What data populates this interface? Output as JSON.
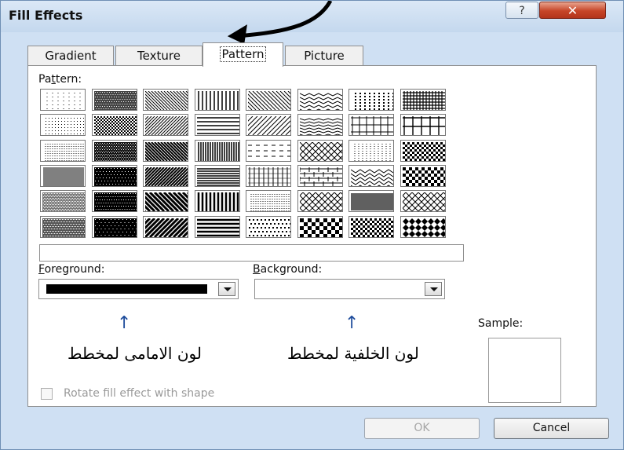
{
  "dialog": {
    "title": "Fill Effects",
    "help_glyph": "?",
    "close_glyph": "✕"
  },
  "tabs": [
    {
      "label": "Gradient",
      "active": false
    },
    {
      "label": "Texture",
      "active": false
    },
    {
      "label": "Pattern",
      "active": true
    },
    {
      "label": "Picture",
      "active": false
    }
  ],
  "pattern": {
    "label_pre": "Pa",
    "label_accel": "t",
    "label_post": "tern:",
    "rows": 6,
    "cols": 8
  },
  "pattern_name": "",
  "foreground": {
    "label_accel": "F",
    "label_rest": "oreground:",
    "color": "#000000"
  },
  "background": {
    "label_accel": "B",
    "label_rest": "ackground:",
    "color": "#ffffff"
  },
  "annotations": {
    "up_arrow": "↑",
    "foreground_note": "لون الامامى لمخطط",
    "background_note": "لون الخلفية لمخطط"
  },
  "sample": {
    "label": "Sample:"
  },
  "rotate": {
    "label": "Rotate fill effect with shape",
    "checked": false
  },
  "buttons": {
    "ok": "OK",
    "cancel": "Cancel"
  }
}
